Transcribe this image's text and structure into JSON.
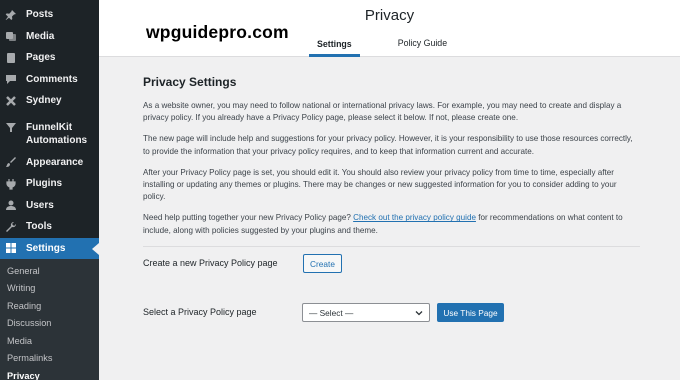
{
  "sidebar": {
    "items": [
      {
        "label": "Posts",
        "icon": "pin-icon"
      },
      {
        "label": "Media",
        "icon": "media-icon"
      },
      {
        "label": "Pages",
        "icon": "page-icon"
      },
      {
        "label": "Comments",
        "icon": "comment-icon"
      },
      {
        "label": "Sydney",
        "icon": "sydney-icon"
      },
      {
        "label": "FunnelKit Automations",
        "icon": "funnelkit-icon"
      },
      {
        "label": "Appearance",
        "icon": "brush-icon"
      },
      {
        "label": "Plugins",
        "icon": "plug-icon"
      },
      {
        "label": "Users",
        "icon": "user-icon"
      },
      {
        "label": "Tools",
        "icon": "wrench-icon"
      },
      {
        "label": "Settings",
        "icon": "settings-icon"
      }
    ],
    "submenu": [
      "General",
      "Writing",
      "Reading",
      "Discussion",
      "Media",
      "Permalinks",
      "Privacy"
    ]
  },
  "header": {
    "brand": "wpguidepro.com",
    "title": "Privacy",
    "tabs": [
      "Settings",
      "Policy Guide"
    ]
  },
  "main": {
    "section_title": "Privacy Settings",
    "paragraphs": [
      "As a website owner, you may need to follow national or international privacy laws. For example, you may need to create and display a privacy policy. If you already have a Privacy Policy page, please select it below. If not, please create one.",
      "The new page will include help and suggestions for your privacy policy. However, it is your responsibility to use those resources correctly, to provide the information that your privacy policy requires, and to keep that information current and accurate.",
      "After your Privacy Policy page is set, you should edit it. You should also review your privacy policy from time to time, especially after installing or updating any themes or plugins. There may be changes or new suggested information for you to consider adding to your policy."
    ],
    "help_prefix": "Need help putting together your new Privacy Policy page? ",
    "help_link": "Check out the privacy policy guide",
    "help_suffix": " for recommendations on what content to include, along with policies suggested by your plugins and theme.",
    "create_label": "Create a new Privacy Policy page",
    "create_button": "Create",
    "select_label": "Select a Privacy Policy page",
    "select_value": "— Select —",
    "use_button": "Use This Page"
  },
  "colors": {
    "accent": "#2271b1",
    "sidebar_bg": "#1d2327",
    "page_bg": "#f0f0f1"
  }
}
